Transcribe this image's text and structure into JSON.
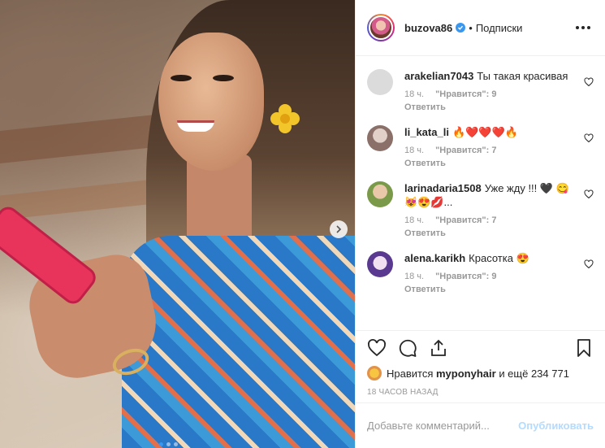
{
  "post": {
    "author": "buzova86",
    "follow_status": "Подписки",
    "dot": "•",
    "slides": {
      "count": 3,
      "active_index": 0
    }
  },
  "comments": [
    {
      "user": "arakelian7043",
      "text": "Ты такая красивая",
      "time": "18 ч.",
      "likes": "\"Нравится\": 9",
      "reply": "Ответить",
      "avatar_color": "#dbdbdb"
    },
    {
      "user": "li_kata_li",
      "text": "🔥❤️❤️❤️🔥",
      "time": "18 ч.",
      "likes": "\"Нравится\": 7",
      "reply": "Ответить",
      "avatar_color": "#b9a8a0"
    },
    {
      "user": "larinadaria1508",
      "text": "Уже жду !!! 🖤 😋😻😍💋...",
      "time": "18 ч.",
      "likes": "\"Нравится\": 7",
      "reply": "Ответить",
      "avatar_color": "#c89a6a"
    },
    {
      "user": "alena.karikh",
      "text": "Красотка 😍",
      "time": "18 ч.",
      "likes": "\"Нравится\": 9",
      "reply": "Ответить",
      "avatar_color": "#6a4aa0"
    }
  ],
  "likes": {
    "prefix": "Нравится",
    "user": "myponyhair",
    "suffix": "и ещё 234 771"
  },
  "time_ago": "18 ЧАСОВ НАЗАД",
  "composer": {
    "placeholder": "Добавьте комментарий...",
    "publish_label": "Опубликовать"
  },
  "colors": {
    "verified": "#3897f0",
    "publish_disabled": "#b3dbff",
    "muted_text": "#999999"
  }
}
